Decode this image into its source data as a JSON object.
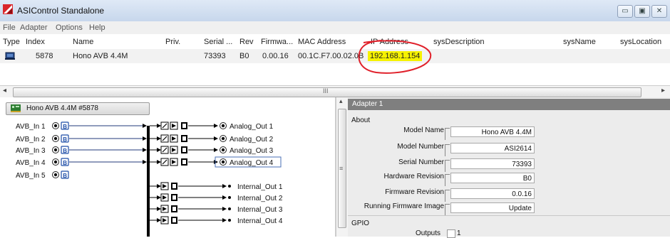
{
  "window": {
    "title": "ASIControl Standalone"
  },
  "menu": [
    "File",
    "Adapter",
    "Options",
    "Help"
  ],
  "table": {
    "headers": [
      "Type",
      "Index",
      "Name",
      "Priv.",
      "Serial ...",
      "Rev",
      "Firmwa...",
      "MAC Address",
      "IP Address",
      "sysDescription",
      "sysName",
      "sysLocation"
    ],
    "row": {
      "index": "5878",
      "name": "Hono AVB 4.4M",
      "priv": "",
      "serial": "73393",
      "rev": "B0",
      "firmware": "0.00.16",
      "mac": "00.1C.F7.00.02.0B",
      "ip": "192.168.1.154",
      "sysdesc": "",
      "sysname": "",
      "syslocation": ""
    },
    "hscroll_glyph": "III"
  },
  "topology": {
    "node_title": "Hono AVB 4.4M #5878",
    "inputs": [
      "AVB_In 1",
      "AVB_In 2",
      "AVB_In 3",
      "AVB_In 4",
      "AVB_In 5"
    ],
    "analog_outputs": [
      "Analog_Out 1",
      "Analog_Out 2",
      "Analog_Out 3",
      "Analog_Out 4"
    ],
    "internal_outputs": [
      "Internal_Out 1",
      "Internal_Out 2",
      "Internal_Out 3",
      "Internal_Out 4"
    ],
    "badge_letter": "B"
  },
  "adapter": {
    "header": "Adapter 1",
    "about_label": "About",
    "props": [
      {
        "label": "Model Name",
        "value": "Hono AVB 4.4M"
      },
      {
        "label": "Model Number",
        "value": "ASI2614"
      },
      {
        "label": "Serial Number",
        "value": "73393"
      },
      {
        "label": "Hardware Revision",
        "value": "B0"
      },
      {
        "label": "Firmware Revision",
        "value": "0.0.16"
      },
      {
        "label": "Running Firmware Image",
        "value": "Update"
      }
    ],
    "gpio_label": "GPIO",
    "outputs_label": "Outputs",
    "outputs_value": "1"
  },
  "colors": {
    "ip_highlight": "#f6f200",
    "annotation_circle": "#e0202a",
    "selected_icon": "#1f4ea8"
  }
}
